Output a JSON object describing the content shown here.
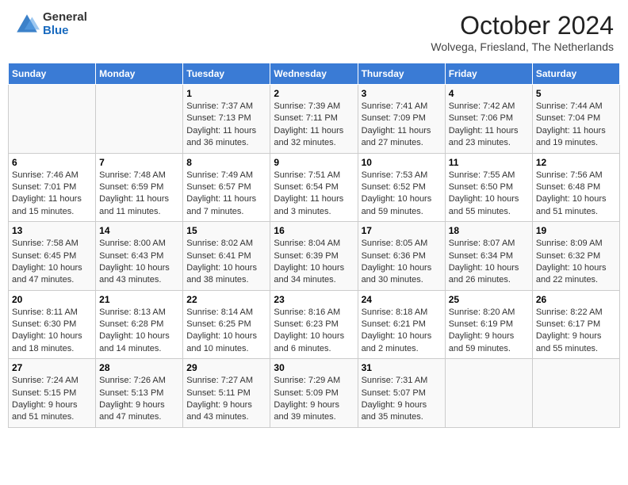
{
  "header": {
    "logo_general": "General",
    "logo_blue": "Blue",
    "title": "October 2024",
    "subtitle": "Wolvega, Friesland, The Netherlands"
  },
  "days_of_week": [
    "Sunday",
    "Monday",
    "Tuesday",
    "Wednesday",
    "Thursday",
    "Friday",
    "Saturday"
  ],
  "weeks": [
    [
      {
        "day": "",
        "sunrise": "",
        "sunset": "",
        "daylight": ""
      },
      {
        "day": "",
        "sunrise": "",
        "sunset": "",
        "daylight": ""
      },
      {
        "day": "1",
        "sunrise": "Sunrise: 7:37 AM",
        "sunset": "Sunset: 7:13 PM",
        "daylight": "Daylight: 11 hours and 36 minutes."
      },
      {
        "day": "2",
        "sunrise": "Sunrise: 7:39 AM",
        "sunset": "Sunset: 7:11 PM",
        "daylight": "Daylight: 11 hours and 32 minutes."
      },
      {
        "day": "3",
        "sunrise": "Sunrise: 7:41 AM",
        "sunset": "Sunset: 7:09 PM",
        "daylight": "Daylight: 11 hours and 27 minutes."
      },
      {
        "day": "4",
        "sunrise": "Sunrise: 7:42 AM",
        "sunset": "Sunset: 7:06 PM",
        "daylight": "Daylight: 11 hours and 23 minutes."
      },
      {
        "day": "5",
        "sunrise": "Sunrise: 7:44 AM",
        "sunset": "Sunset: 7:04 PM",
        "daylight": "Daylight: 11 hours and 19 minutes."
      }
    ],
    [
      {
        "day": "6",
        "sunrise": "Sunrise: 7:46 AM",
        "sunset": "Sunset: 7:01 PM",
        "daylight": "Daylight: 11 hours and 15 minutes."
      },
      {
        "day": "7",
        "sunrise": "Sunrise: 7:48 AM",
        "sunset": "Sunset: 6:59 PM",
        "daylight": "Daylight: 11 hours and 11 minutes."
      },
      {
        "day": "8",
        "sunrise": "Sunrise: 7:49 AM",
        "sunset": "Sunset: 6:57 PM",
        "daylight": "Daylight: 11 hours and 7 minutes."
      },
      {
        "day": "9",
        "sunrise": "Sunrise: 7:51 AM",
        "sunset": "Sunset: 6:54 PM",
        "daylight": "Daylight: 11 hours and 3 minutes."
      },
      {
        "day": "10",
        "sunrise": "Sunrise: 7:53 AM",
        "sunset": "Sunset: 6:52 PM",
        "daylight": "Daylight: 10 hours and 59 minutes."
      },
      {
        "day": "11",
        "sunrise": "Sunrise: 7:55 AM",
        "sunset": "Sunset: 6:50 PM",
        "daylight": "Daylight: 10 hours and 55 minutes."
      },
      {
        "day": "12",
        "sunrise": "Sunrise: 7:56 AM",
        "sunset": "Sunset: 6:48 PM",
        "daylight": "Daylight: 10 hours and 51 minutes."
      }
    ],
    [
      {
        "day": "13",
        "sunrise": "Sunrise: 7:58 AM",
        "sunset": "Sunset: 6:45 PM",
        "daylight": "Daylight: 10 hours and 47 minutes."
      },
      {
        "day": "14",
        "sunrise": "Sunrise: 8:00 AM",
        "sunset": "Sunset: 6:43 PM",
        "daylight": "Daylight: 10 hours and 43 minutes."
      },
      {
        "day": "15",
        "sunrise": "Sunrise: 8:02 AM",
        "sunset": "Sunset: 6:41 PM",
        "daylight": "Daylight: 10 hours and 38 minutes."
      },
      {
        "day": "16",
        "sunrise": "Sunrise: 8:04 AM",
        "sunset": "Sunset: 6:39 PM",
        "daylight": "Daylight: 10 hours and 34 minutes."
      },
      {
        "day": "17",
        "sunrise": "Sunrise: 8:05 AM",
        "sunset": "Sunset: 6:36 PM",
        "daylight": "Daylight: 10 hours and 30 minutes."
      },
      {
        "day": "18",
        "sunrise": "Sunrise: 8:07 AM",
        "sunset": "Sunset: 6:34 PM",
        "daylight": "Daylight: 10 hours and 26 minutes."
      },
      {
        "day": "19",
        "sunrise": "Sunrise: 8:09 AM",
        "sunset": "Sunset: 6:32 PM",
        "daylight": "Daylight: 10 hours and 22 minutes."
      }
    ],
    [
      {
        "day": "20",
        "sunrise": "Sunrise: 8:11 AM",
        "sunset": "Sunset: 6:30 PM",
        "daylight": "Daylight: 10 hours and 18 minutes."
      },
      {
        "day": "21",
        "sunrise": "Sunrise: 8:13 AM",
        "sunset": "Sunset: 6:28 PM",
        "daylight": "Daylight: 10 hours and 14 minutes."
      },
      {
        "day": "22",
        "sunrise": "Sunrise: 8:14 AM",
        "sunset": "Sunset: 6:25 PM",
        "daylight": "Daylight: 10 hours and 10 minutes."
      },
      {
        "day": "23",
        "sunrise": "Sunrise: 8:16 AM",
        "sunset": "Sunset: 6:23 PM",
        "daylight": "Daylight: 10 hours and 6 minutes."
      },
      {
        "day": "24",
        "sunrise": "Sunrise: 8:18 AM",
        "sunset": "Sunset: 6:21 PM",
        "daylight": "Daylight: 10 hours and 2 minutes."
      },
      {
        "day": "25",
        "sunrise": "Sunrise: 8:20 AM",
        "sunset": "Sunset: 6:19 PM",
        "daylight": "Daylight: 9 hours and 59 minutes."
      },
      {
        "day": "26",
        "sunrise": "Sunrise: 8:22 AM",
        "sunset": "Sunset: 6:17 PM",
        "daylight": "Daylight: 9 hours and 55 minutes."
      }
    ],
    [
      {
        "day": "27",
        "sunrise": "Sunrise: 7:24 AM",
        "sunset": "Sunset: 5:15 PM",
        "daylight": "Daylight: 9 hours and 51 minutes."
      },
      {
        "day": "28",
        "sunrise": "Sunrise: 7:26 AM",
        "sunset": "Sunset: 5:13 PM",
        "daylight": "Daylight: 9 hours and 47 minutes."
      },
      {
        "day": "29",
        "sunrise": "Sunrise: 7:27 AM",
        "sunset": "Sunset: 5:11 PM",
        "daylight": "Daylight: 9 hours and 43 minutes."
      },
      {
        "day": "30",
        "sunrise": "Sunrise: 7:29 AM",
        "sunset": "Sunset: 5:09 PM",
        "daylight": "Daylight: 9 hours and 39 minutes."
      },
      {
        "day": "31",
        "sunrise": "Sunrise: 7:31 AM",
        "sunset": "Sunset: 5:07 PM",
        "daylight": "Daylight: 9 hours and 35 minutes."
      },
      {
        "day": "",
        "sunrise": "",
        "sunset": "",
        "daylight": ""
      },
      {
        "day": "",
        "sunrise": "",
        "sunset": "",
        "daylight": ""
      }
    ]
  ]
}
